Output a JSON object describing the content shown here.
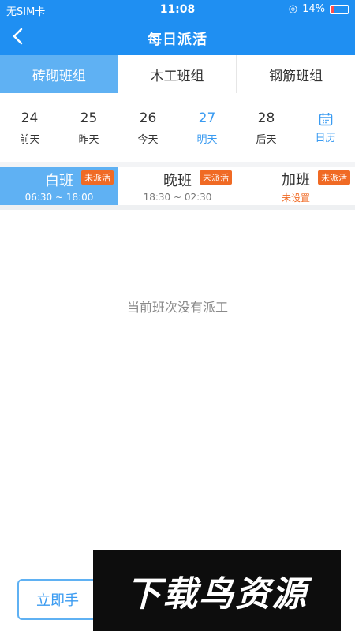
{
  "status": {
    "carrier": "无SIM卡",
    "time": "11:08",
    "battery": "14%",
    "battery_level": 0.14
  },
  "navbar": {
    "title": "每日派活"
  },
  "tabs": [
    {
      "label": "砖砌班组"
    },
    {
      "label": "木工班组"
    },
    {
      "label": "钢筋班组"
    }
  ],
  "dates": [
    {
      "num": "24",
      "label": "前天"
    },
    {
      "num": "25",
      "label": "昨天"
    },
    {
      "num": "26",
      "label": "今天"
    },
    {
      "num": "27",
      "label": "明天"
    },
    {
      "num": "28",
      "label": "后天"
    }
  ],
  "calendar": {
    "label": "日历"
  },
  "shifts": [
    {
      "name": "白班",
      "time": "06:30 ~ 18:00",
      "badge": "未派活"
    },
    {
      "name": "晚班",
      "time": "18:30 ~ 02:30",
      "badge": "未派活"
    },
    {
      "name": "加班",
      "time": "未设置",
      "badge": "未派活"
    }
  ],
  "empty": {
    "message": "当前班次没有派工"
  },
  "actions": {
    "dispatch_button": "立即手"
  },
  "watermark": {
    "text": "下载鸟资源"
  }
}
